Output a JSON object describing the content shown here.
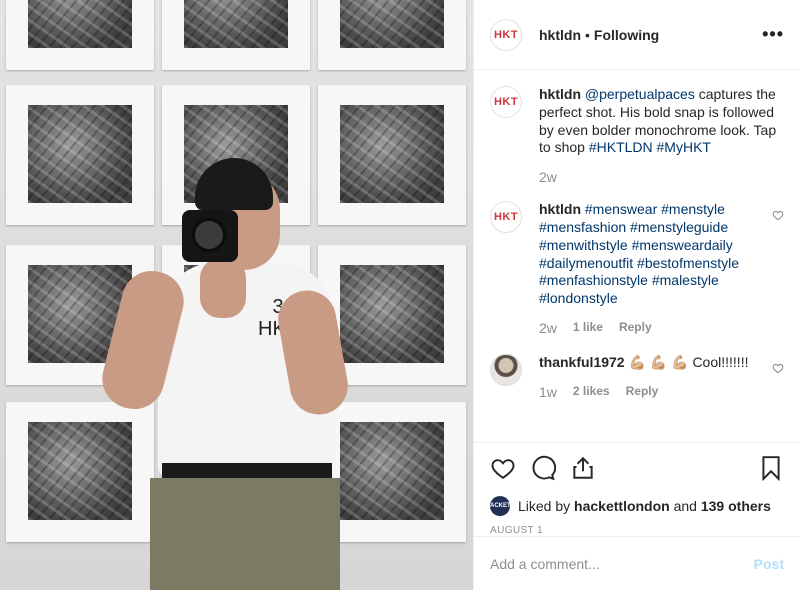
{
  "post": {
    "account": "hktldn",
    "avatar_text": "HKT",
    "follow_separator": "•",
    "follow_status": "Following",
    "more_icon": "more-horizontal-icon",
    "photo_tshirt_text": "3\nHKT"
  },
  "comments": [
    {
      "user": "hktldn",
      "avatar": "HKT",
      "segments": [
        {
          "t": "@perpetualpaces",
          "link": true
        },
        {
          "t": " captures the perfect shot. His bold snap is followed by even bolder monochrome look. Tap to shop ",
          "link": false
        },
        {
          "t": "#HKTLDN",
          "link": true
        },
        {
          "t": " ",
          "link": false
        },
        {
          "t": "#MyHKT",
          "link": true
        }
      ],
      "ago": "2w",
      "likes": "",
      "reply": "",
      "heart": false
    },
    {
      "user": "hktldn",
      "avatar": "HKT",
      "segments": [
        {
          "t": "#menswear #menstyle #mensfashion #menstyleguide #menwithstyle #mensweardaily #dailymenoutfit #bestofmenstyle #menfashionstyle #malestyle #londonstyle",
          "link": true
        }
      ],
      "ago": "2w",
      "likes": "1 like",
      "reply": "Reply",
      "heart": true
    },
    {
      "user": "thankful1972",
      "avatar": "",
      "segments": [
        {
          "t": "💪🏼 💪🏼 💪🏼 Cool!!!!!!!",
          "link": false
        }
      ],
      "ago": "1w",
      "likes": "2 likes",
      "reply": "Reply",
      "heart": true
    }
  ],
  "actions": {
    "like_icon": "heart-icon",
    "comment_icon": "comment-icon",
    "share_icon": "share-icon",
    "save_icon": "bookmark-icon"
  },
  "likes": {
    "avatar_text": "HACKETT",
    "prefix": "Liked by ",
    "user": "hackettlondon",
    "middle": " and ",
    "others": "139 others"
  },
  "date": "AUGUST 1",
  "add_comment": {
    "placeholder": "Add a comment...",
    "post_label": "Post"
  }
}
